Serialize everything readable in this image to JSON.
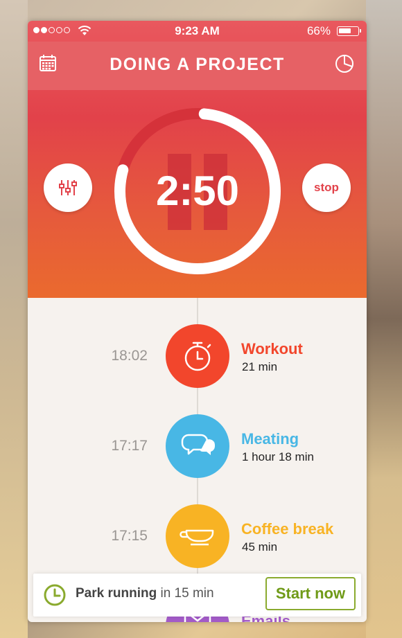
{
  "status": {
    "time": "9:23 AM",
    "battery": "66%",
    "battery_level": 0.66
  },
  "header": {
    "title": "DOING A PROJECT"
  },
  "timer": {
    "value": "2:50",
    "progress": 0.78
  },
  "controls": {
    "stop_label": "stop"
  },
  "timeline": [
    {
      "time": "18:02",
      "title": "Workout",
      "duration": "21 min",
      "color": "#f2462c",
      "icon": "stopwatch-icon"
    },
    {
      "time": "17:17",
      "title": "Meating",
      "duration": "1 hour 18 min",
      "color": "#48b7e5",
      "icon": "chat-bubbles-icon"
    },
    {
      "time": "17:15",
      "title": "Coffee break",
      "duration": "45 min",
      "color": "#f8b324",
      "icon": "coffee-cup-icon"
    },
    {
      "time": "",
      "title": "Emails",
      "duration": "",
      "color": "#a35bc8",
      "icon": "envelope-icon"
    }
  ],
  "reminder": {
    "activity": "Park running",
    "suffix": " in 15 min",
    "action": "Start now"
  },
  "colors": {
    "accent": "#e2424a",
    "green": "#8aaa2e"
  }
}
